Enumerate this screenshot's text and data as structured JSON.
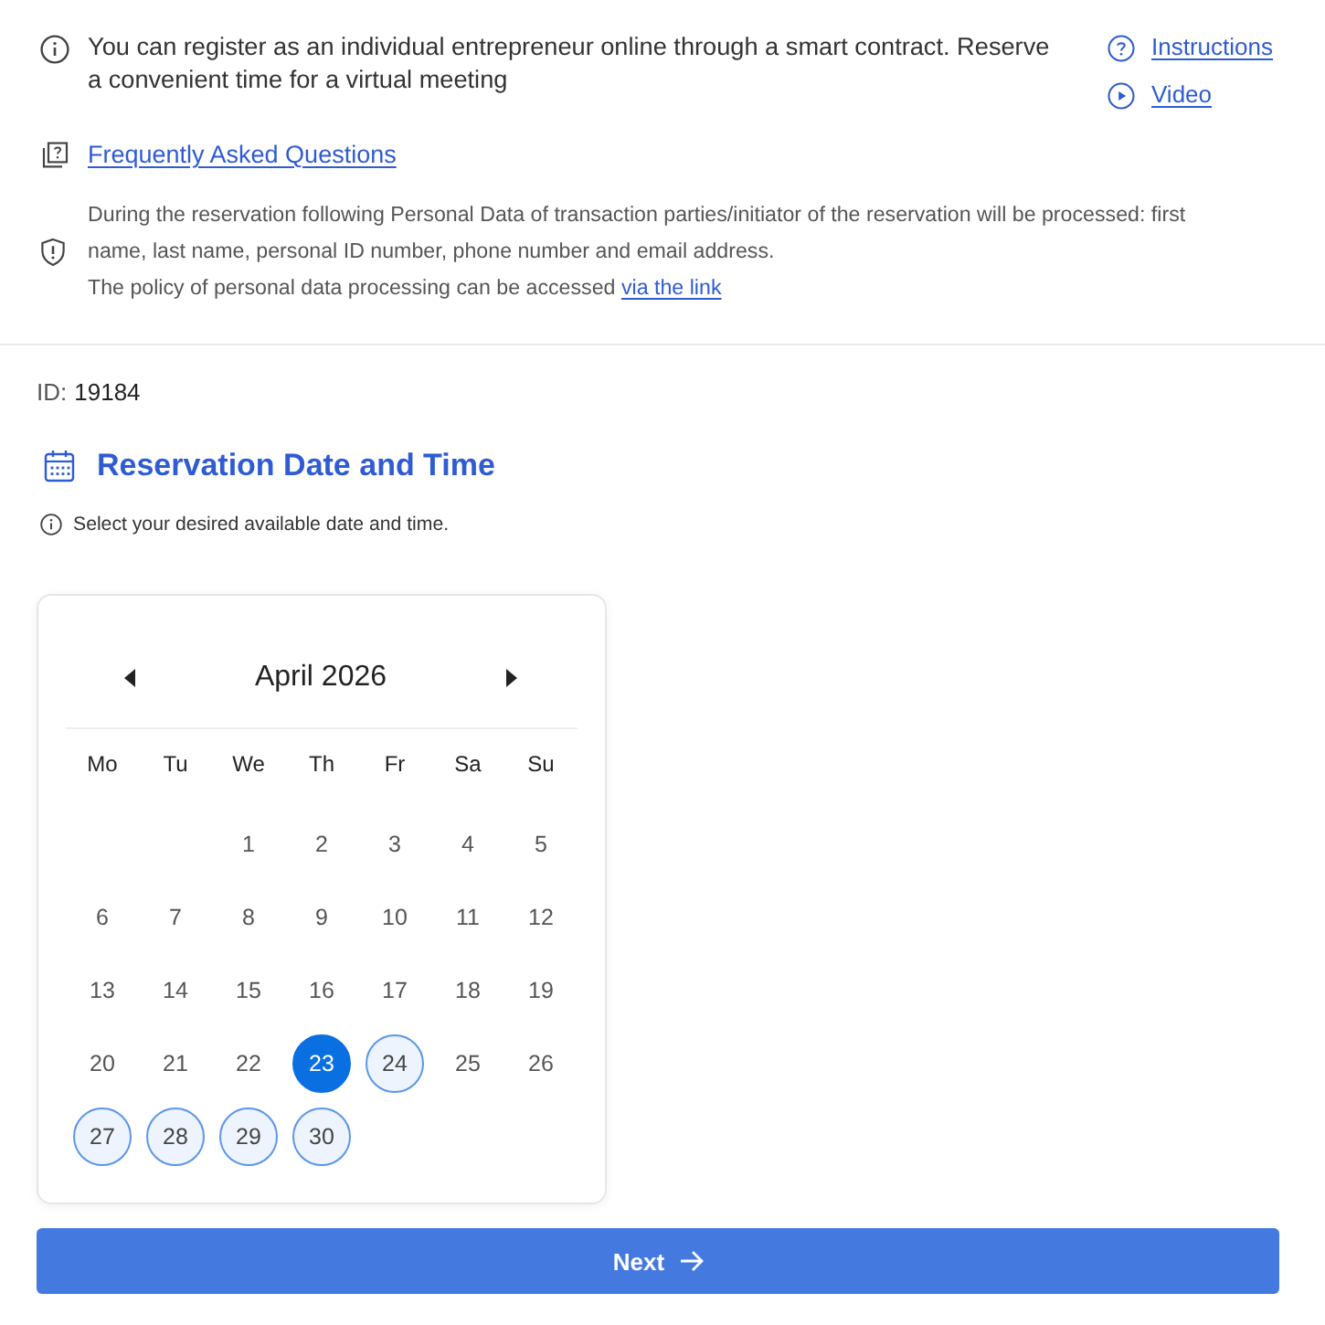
{
  "notice": {
    "text": "You can register as an individual entrepreneur online through a smart contract. Reserve a convenient time for a virtual meeting",
    "links": [
      "Instructions",
      "Video"
    ]
  },
  "faq_link": "Frequently Asked Questions",
  "privacy": {
    "text": "During the reservation following Personal Data of transaction parties/initiator of the reservation will be processed: first name, last name, personal ID number, phone number and email address.",
    "policy_text": "The policy of personal data processing can be accessed",
    "policy_link": "via the link"
  },
  "record": {
    "label": "ID:",
    "value": "19184"
  },
  "section_title": "Reservation Date and Time",
  "hint": "Select your desired available date and time.",
  "calendar": {
    "month": "April 2026",
    "weekdays": [
      "Mo",
      "Tu",
      "We",
      "Th",
      "Fr",
      "Sa",
      "Su"
    ],
    "weeks": [
      [
        {
          "day": "1",
          "available": false,
          "selected": false
        },
        {
          "day": "2",
          "available": false,
          "selected": false
        },
        {
          "day": "3",
          "available": false,
          "selected": false
        },
        {
          "day": "4",
          "available": false,
          "selected": false
        },
        {
          "day": "5",
          "available": false,
          "selected": false
        }
      ],
      [
        {
          "day": "6",
          "available": false,
          "selected": false
        },
        {
          "day": "7",
          "available": false,
          "selected": false
        },
        {
          "day": "8",
          "available": false,
          "selected": false
        },
        {
          "day": "9",
          "available": false,
          "selected": false
        },
        {
          "day": "10",
          "available": false,
          "selected": false
        },
        {
          "day": "11",
          "available": false,
          "selected": false
        },
        {
          "day": "12",
          "available": false,
          "selected": false
        }
      ],
      [
        {
          "day": "13",
          "available": false,
          "selected": false
        },
        {
          "day": "14",
          "available": false,
          "selected": false
        },
        {
          "day": "15",
          "available": false,
          "selected": false
        },
        {
          "day": "16",
          "available": false,
          "selected": false
        },
        {
          "day": "17",
          "available": false,
          "selected": false
        },
        {
          "day": "18",
          "available": false,
          "selected": false
        },
        {
          "day": "19",
          "available": false,
          "selected": false
        }
      ],
      [
        {
          "day": "20",
          "available": false,
          "selected": false
        },
        {
          "day": "21",
          "available": false,
          "selected": false
        },
        {
          "day": "22",
          "available": false,
          "selected": false
        },
        {
          "day": "23",
          "available": true,
          "selected": true
        },
        {
          "day": "24",
          "available": true,
          "selected": false
        },
        {
          "day": "25",
          "available": false,
          "selected": false
        },
        {
          "day": "26",
          "available": false,
          "selected": false
        }
      ],
      [
        {
          "day": "27",
          "available": true,
          "selected": false
        },
        {
          "day": "28",
          "available": true,
          "selected": false
        },
        {
          "day": "29",
          "available": true,
          "selected": false
        },
        {
          "day": "30",
          "available": true,
          "selected": false
        }
      ]
    ]
  },
  "next_button": "Next"
}
